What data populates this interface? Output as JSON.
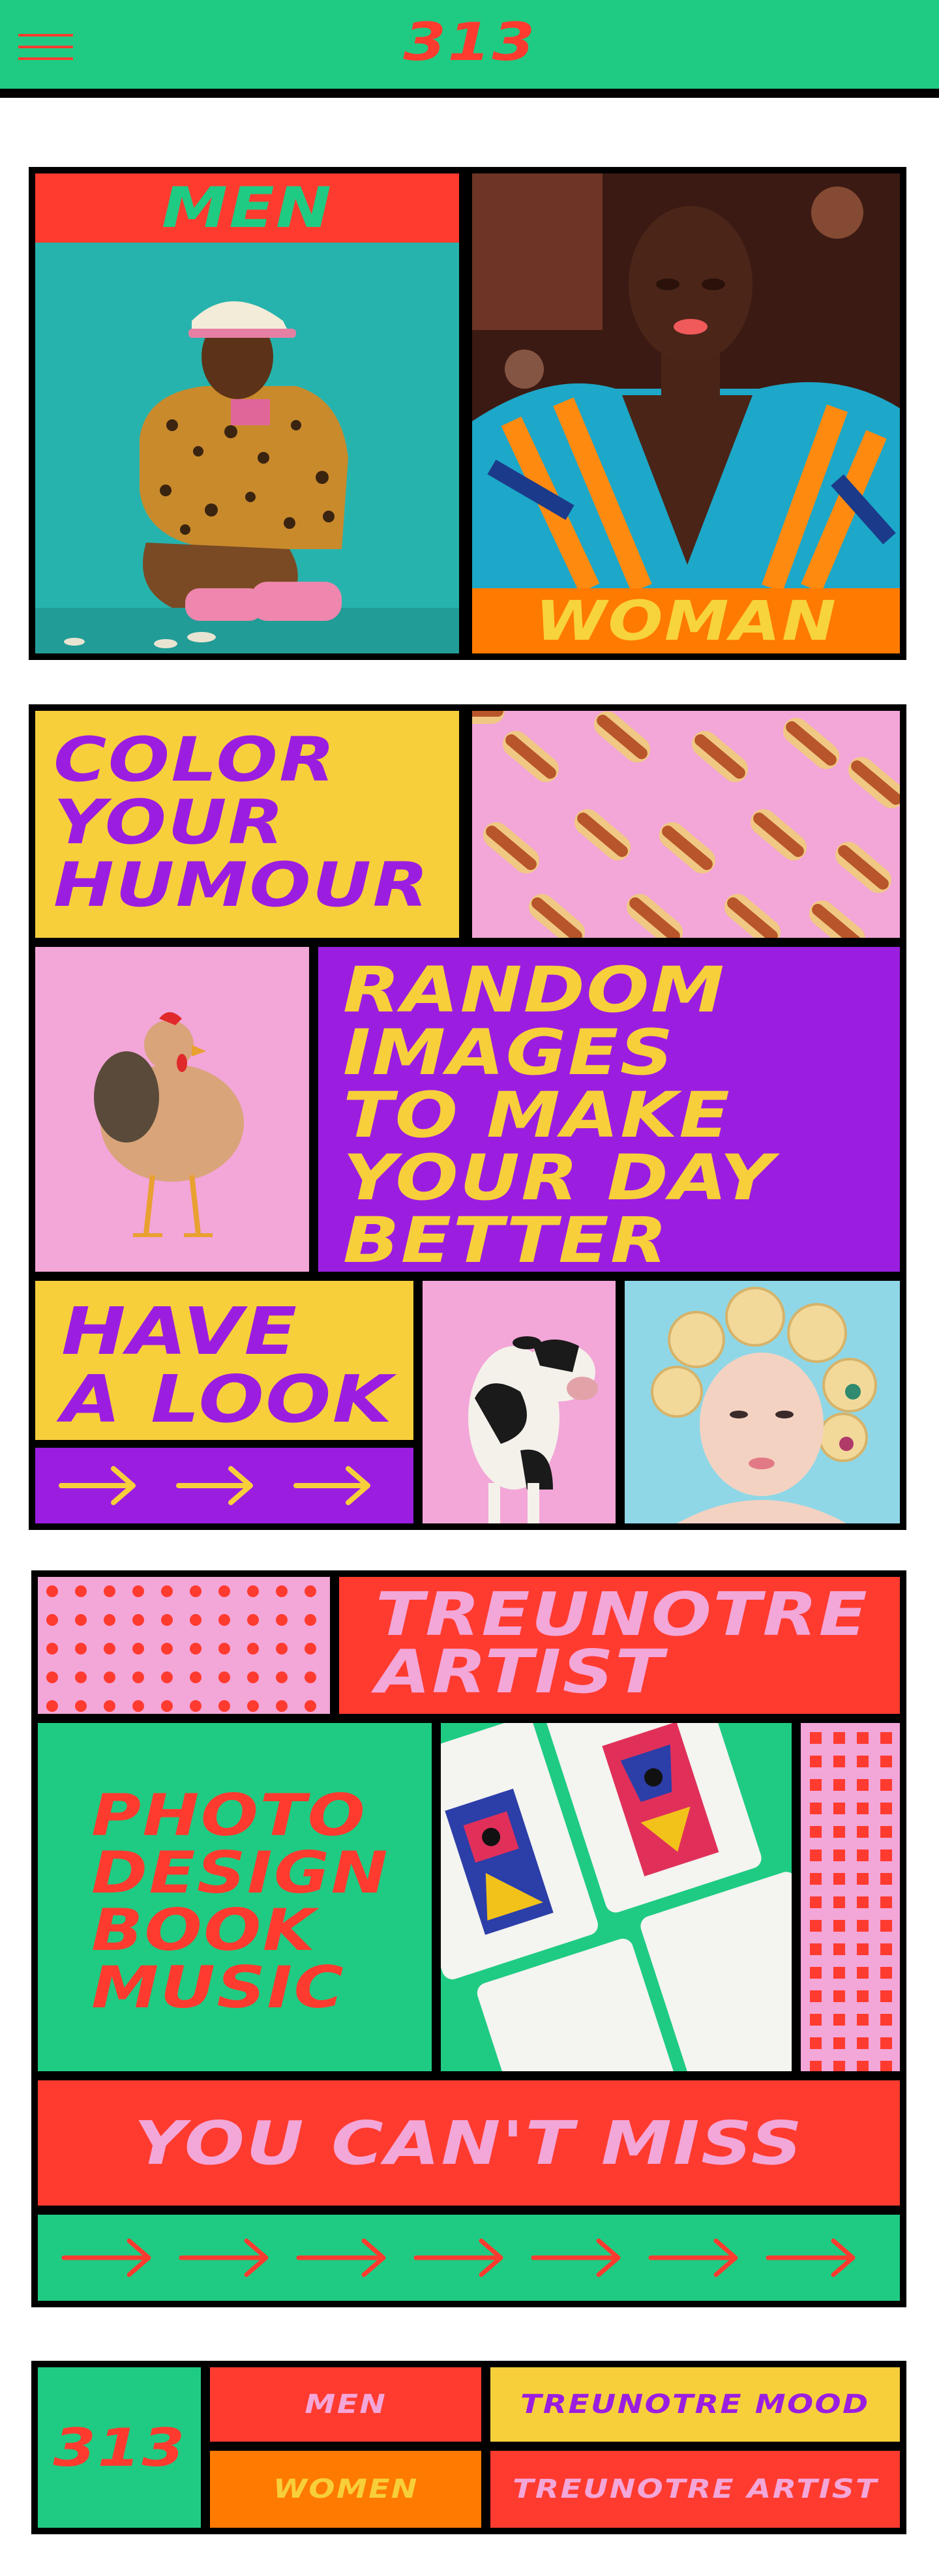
{
  "header": {
    "logo": "313",
    "menu_icon": "hamburger-menu-icon"
  },
  "gender": {
    "men_label": "MEN",
    "woman_label": "WOMAN"
  },
  "humour": {
    "title_lines": [
      "COLOR",
      "YOUR",
      "HUMOUR"
    ],
    "random_lines": [
      "RANDOM",
      "IMAGES",
      "TO MAKE",
      "YOUR DAY",
      "BETTER"
    ],
    "look_lines": [
      "HAVE",
      "A LOOK"
    ]
  },
  "artist": {
    "title_lines": [
      "TREUNOTRE",
      "ARTIST"
    ],
    "categories": [
      "PHOTO",
      "DESIGN",
      "BOOK",
      "MUSIC"
    ],
    "cta": "YOU CAN'T MISS"
  },
  "footer": {
    "logo": "313",
    "links": {
      "men": "MEN",
      "mood": "TREUNOTRE MOOD",
      "women": "WOMEN",
      "artist": "TREUNOTRE ARTIST"
    }
  },
  "colors": {
    "green": "#1fcb83",
    "red": "#ff3b2f",
    "yellow": "#f7cf3b",
    "purple": "#9b1ee0",
    "pink": "#f3a6d8",
    "orange": "#ff7a00",
    "black": "#000000"
  }
}
